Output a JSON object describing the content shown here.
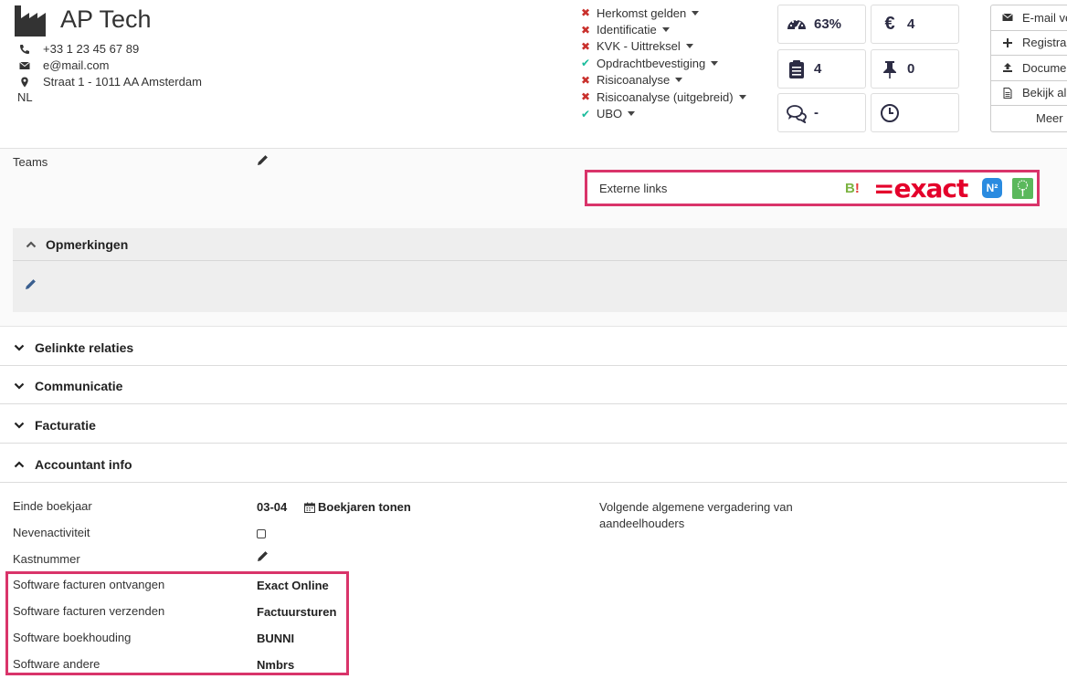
{
  "company": {
    "name": "AP Tech",
    "phone": "+33 1 23 45 67 89",
    "email": "e@mail.com",
    "address": "Straat 1 - 1011 AA Amsterdam",
    "country": "NL"
  },
  "checklist": [
    {
      "label": "Herkomst gelden",
      "status": "missing"
    },
    {
      "label": "Identificatie",
      "status": "missing"
    },
    {
      "label": "KVK - Uittreksel",
      "status": "missing"
    },
    {
      "label": "Opdrachtbevestiging",
      "status": "done"
    },
    {
      "label": "Risicoanalyse",
      "status": "missing"
    },
    {
      "label": "Risicoanalyse (uitgebreid)",
      "status": "missing"
    },
    {
      "label": "UBO",
      "status": "done"
    }
  ],
  "stats": {
    "progress": "63%",
    "euro": "4",
    "tasks": "4",
    "pins": "0",
    "comments": "-",
    "time": ""
  },
  "actions": {
    "email": "E-mail ve",
    "register": "Registra",
    "documents": "Docume",
    "view_all": "Bekijk al",
    "more": "Meer"
  },
  "teams": {
    "label": "Teams"
  },
  "external_links": {
    "label": "Externe links",
    "bl": "B!",
    "exact": "=exact",
    "n": "N²"
  },
  "remarks": {
    "title": "Opmerkingen"
  },
  "sections": {
    "linked_relations": "Gelinkte relaties",
    "communication": "Communicatie",
    "billing": "Facturatie",
    "accountant_info": "Accountant info"
  },
  "accountant": {
    "fiscal_year_label": "Einde boekjaar",
    "fiscal_year_value": "03-04",
    "show_years": "Boekjaren tonen",
    "side_activity_label": "Nevenactiviteit",
    "cash_number_label": "Kastnummer",
    "next_meeting_label": "Volgende algemene vergadering van aandeelhouders",
    "software": [
      {
        "label": "Software facturen ontvangen",
        "value": "Exact Online"
      },
      {
        "label": "Software facturen verzenden",
        "value": "Factuursturen"
      },
      {
        "label": "Software boekhouding",
        "value": "BUNNI"
      },
      {
        "label": "Software andere",
        "value": "Nmbrs"
      }
    ]
  },
  "colors": {
    "accent_highlight": "#d9346a",
    "check_ok": "#1abc9c",
    "check_missing": "#c9302c",
    "exact_red": "#e4002b"
  }
}
